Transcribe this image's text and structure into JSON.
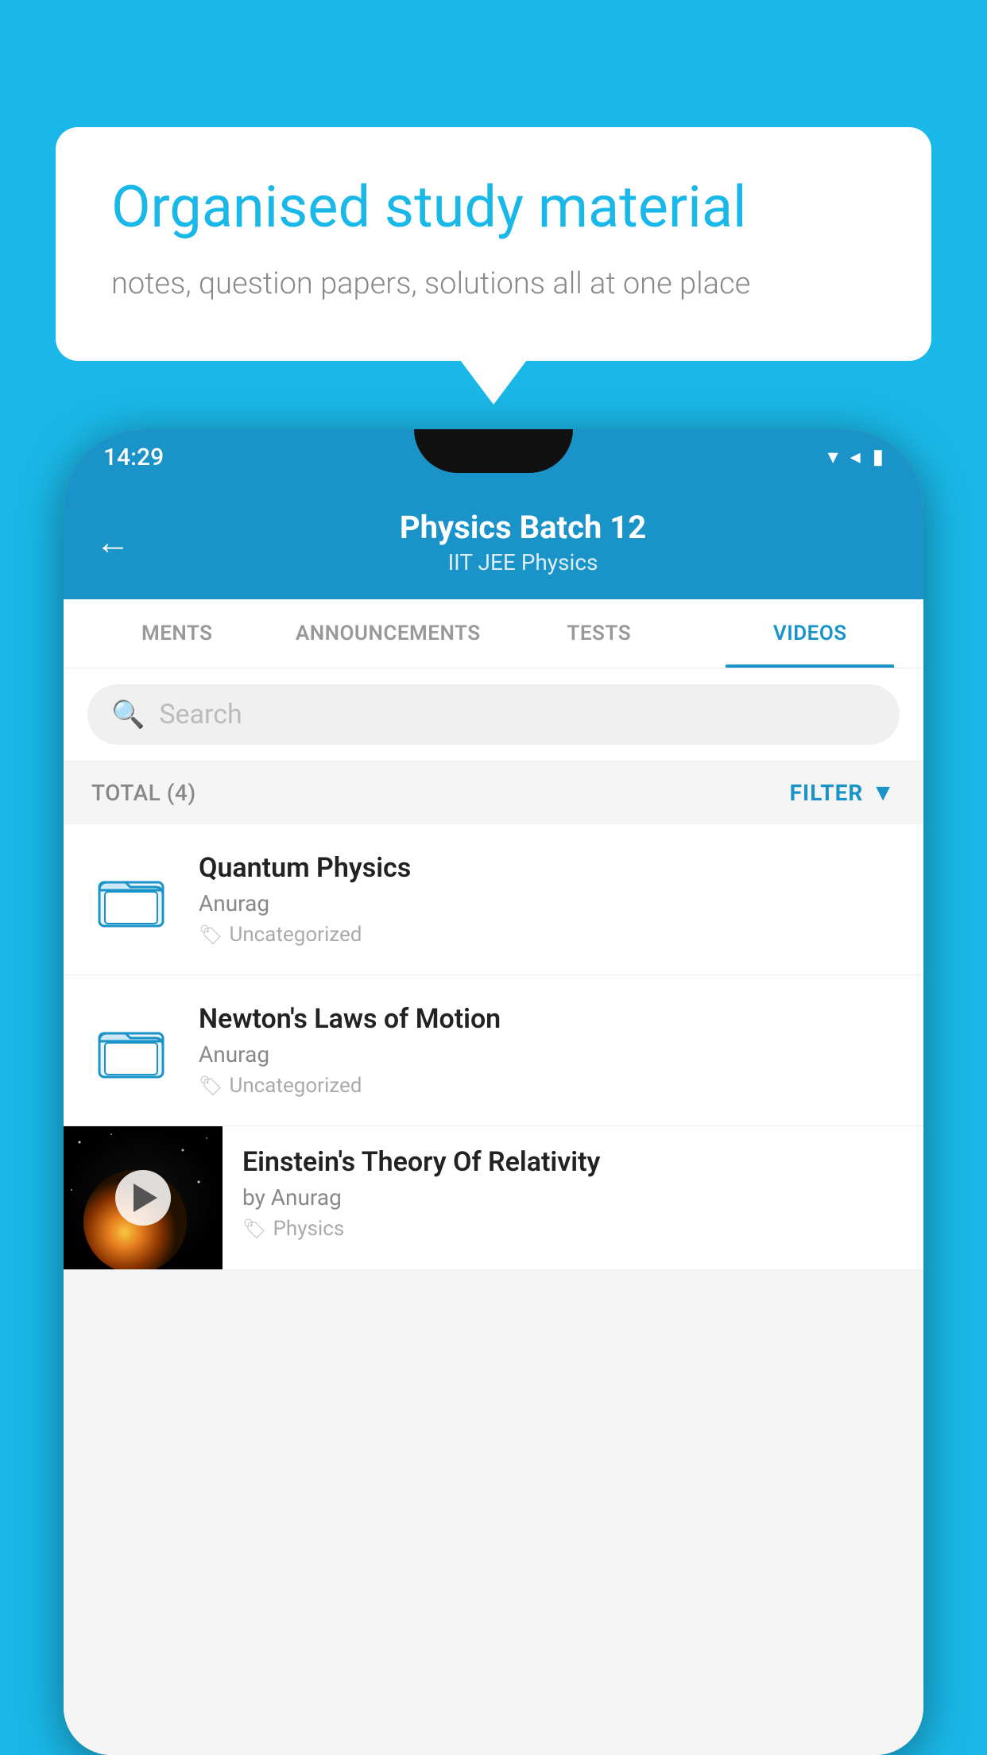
{
  "background_color": "#1ab8e8",
  "speech_bubble": {
    "title": "Organised study material",
    "subtitle": "notes, question papers, solutions all at one place"
  },
  "status_bar": {
    "time": "14:29",
    "icons": [
      "wifi",
      "signal",
      "battery"
    ]
  },
  "app_bar": {
    "back_label": "←",
    "title": "Physics Batch 12",
    "subtitle": "IIT JEE   Physics"
  },
  "tabs": [
    {
      "label": "MENTS",
      "active": false
    },
    {
      "label": "ANNOUNCEMENTS",
      "active": false
    },
    {
      "label": "TESTS",
      "active": false
    },
    {
      "label": "VIDEOS",
      "active": true
    }
  ],
  "search": {
    "placeholder": "Search"
  },
  "filter_row": {
    "total_label": "TOTAL (4)",
    "filter_label": "FILTER"
  },
  "video_items": [
    {
      "title": "Quantum Physics",
      "author": "Anurag",
      "tag": "Uncategorized",
      "type": "folder"
    },
    {
      "title": "Newton's Laws of Motion",
      "author": "Anurag",
      "tag": "Uncategorized",
      "type": "folder"
    },
    {
      "title": "Einstein's Theory Of Relativity",
      "author": "by Anurag",
      "tag": "Physics",
      "type": "video"
    }
  ]
}
